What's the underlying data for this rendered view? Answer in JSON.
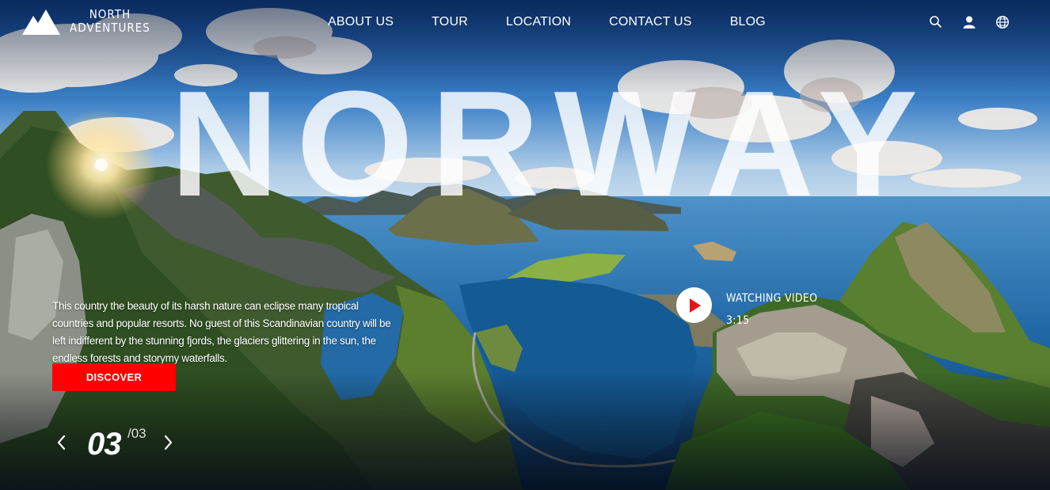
{
  "logo": {
    "line1": "NORTH",
    "line2": "ADVENTURES"
  },
  "nav": {
    "items": [
      "ABOUT US",
      "TOUR",
      "LOCATION",
      "CONTACT US",
      "BLOG"
    ]
  },
  "header_icons": [
    "search-icon",
    "user-icon",
    "globe-icon"
  ],
  "hero": {
    "title": "NORWAY",
    "description": "This country the beauty of its harsh nature can eclipse many tropical countries and popular resorts. No guest of this Scandinavian country will be left indifferent by the stunning fjords, the glaciers glittering in the sun, the endless forests and storymy waterfalls.",
    "cta_label": "DISCOVER"
  },
  "pager": {
    "current": "03",
    "total": "/03"
  },
  "video": {
    "label": "WATCHING VIDEO",
    "duration": "3:15"
  },
  "colors": {
    "accent": "#ff0000",
    "play_icon": "#e8141b",
    "sky": "#1f5fa8",
    "sea": "#145a94"
  }
}
